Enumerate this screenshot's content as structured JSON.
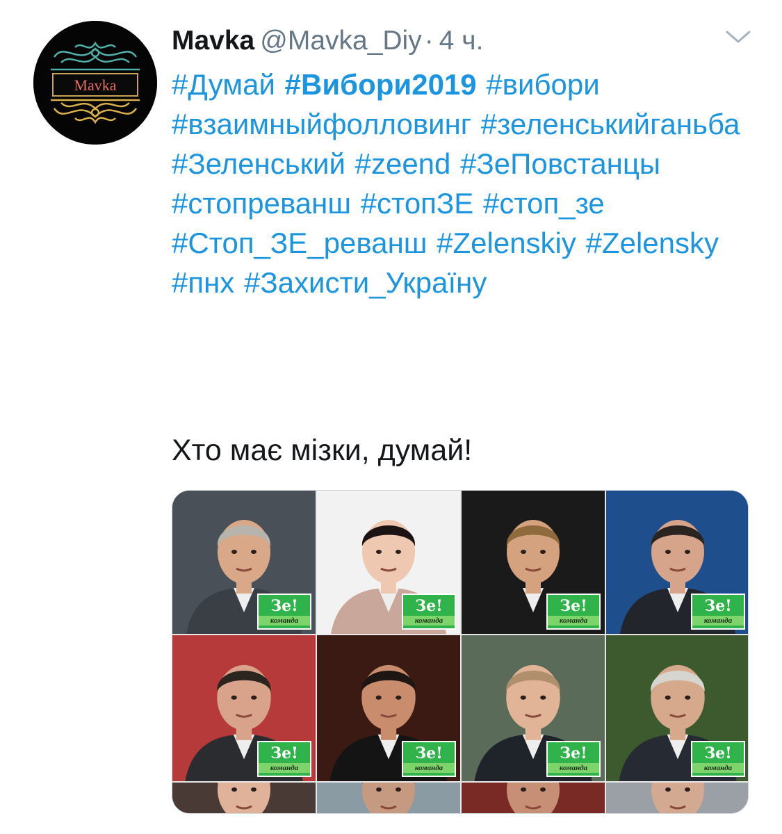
{
  "tweet": {
    "author": {
      "display_name": "Mavka",
      "handle": "@Mavka_Diy",
      "avatar_label": "Mavka",
      "avatar_icon": "ornament-logo-icon"
    },
    "separator": "·",
    "timestamp": "4 ч.",
    "menu_icon": "chevron-down-icon",
    "hashtags": [
      {
        "text": "#Думай",
        "bold": false
      },
      {
        "text": "#Вибори2019",
        "bold": true
      },
      {
        "text": "#вибори",
        "bold": false
      },
      {
        "text": "#взаимныйфолловинг",
        "bold": false
      },
      {
        "text": "#зеленськийганьба",
        "bold": false
      },
      {
        "text": "#Зеленський",
        "bold": false
      },
      {
        "text": "#zeend",
        "bold": false
      },
      {
        "text": "#ЗеПовстанцы",
        "bold": false
      },
      {
        "text": "#стопреванш",
        "bold": false
      },
      {
        "text": "#стопЗЕ",
        "bold": false
      },
      {
        "text": "#стоп_зе",
        "bold": false
      },
      {
        "text": "#Стоп_ЗЕ_реванш",
        "bold": false
      },
      {
        "text": "#Zelenskiy",
        "bold": false
      },
      {
        "text": "#Zelensky",
        "bold": false
      },
      {
        "text": "#пнх",
        "bold": false
      },
      {
        "text": "#Захисти_Україну",
        "bold": false
      }
    ],
    "body": "Хто має мізки, думай!",
    "media": {
      "badge_main": "Зе!",
      "badge_sub": "команда",
      "panels": [
        {
          "name": "photo-man-glasses-gray-beard",
          "bg": "#4a5058",
          "skin": "#d9a889",
          "hair": "#b7b4ad",
          "suit": "#3a3f46",
          "badge": true
        },
        {
          "name": "photo-woman-short-dark-hair",
          "bg": "#f2f2f2",
          "skin": "#efc8b1",
          "hair": "#1c1414",
          "suit": "#c9a79a",
          "badge": true
        },
        {
          "name": "photo-man-round-orange-glasses",
          "bg": "#1a1a1a",
          "skin": "#d5a27f",
          "hair": "#8f6a3c",
          "suit": "#1a1a1a",
          "badge": true
        },
        {
          "name": "photo-man-at-podium-flag",
          "bg": "#1f4e8c",
          "skin": "#d6a48a",
          "hair": "#2a2421",
          "suit": "#22252b",
          "badge": true
        },
        {
          "name": "photo-man-beard-flag-background",
          "bg": "#b63a3a",
          "skin": "#d9a38b",
          "hair": "#2b241f",
          "suit": "#2a2c30",
          "badge": true
        },
        {
          "name": "photo-man-dark-background",
          "bg": "#3a1a12",
          "skin": "#c98d6d",
          "hair": "#1e1612",
          "suit": "#141414",
          "badge": true
        },
        {
          "name": "photo-man-smiling-suit",
          "bg": "#5b6b5a",
          "skin": "#e2b497",
          "hair": "#b08f6d",
          "suit": "#1f232a",
          "badge": true
        },
        {
          "name": "photo-man-gray-hair-glasses",
          "bg": "#3d5a2e",
          "skin": "#d7a98c",
          "hair": "#d7d5d0",
          "suit": "#262a32",
          "badge": true
        },
        {
          "name": "photo-partial-blond",
          "bg": "#4a3a35",
          "skin": "#e0b29a",
          "hair": "#d9b679",
          "suit": "#303030",
          "badge": false
        },
        {
          "name": "photo-partial-cap",
          "bg": "#8a9ba3",
          "skin": "#c69a80",
          "hair": "#2d4f59",
          "suit": "#303030",
          "badge": false
        },
        {
          "name": "photo-partial-red-pattern",
          "bg": "#7a2a25",
          "skin": "#c79076",
          "hair": "#3a2f2a",
          "suit": "#303030",
          "badge": false
        },
        {
          "name": "photo-partial-gray",
          "bg": "#9aa0a5",
          "skin": "#d3a992",
          "hair": "#b9b9b9",
          "suit": "#303030",
          "badge": false
        }
      ]
    }
  }
}
